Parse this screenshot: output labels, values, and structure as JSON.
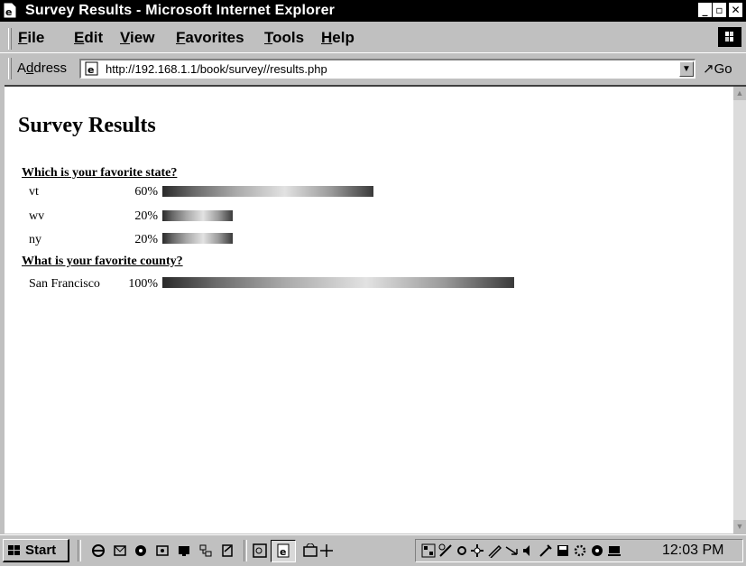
{
  "window": {
    "title": "Survey Results - Microsoft Internet Explorer",
    "controls": {
      "minimize": "_",
      "maximize": "▫",
      "close": "✕"
    }
  },
  "menu": [
    "File",
    "Edit",
    "View",
    "Favorites",
    "Tools",
    "Help"
  ],
  "address_bar": {
    "label_prefix": "A",
    "label_underlined": "d",
    "label_rest": "dress",
    "url": "http://192.168.1.1/book/survey//results.php",
    "go": "Go"
  },
  "page": {
    "heading": "Survey Results",
    "questions": [
      {
        "question": "Which is your favorite state?",
        "answers": [
          {
            "label": "vt",
            "percent_text": "60%",
            "percent": 60
          },
          {
            "label": "wv",
            "percent_text": "20%",
            "percent": 20
          },
          {
            "label": "ny",
            "percent_text": "20%",
            "percent": 20
          }
        ]
      },
      {
        "question": "What is your favorite county?",
        "answers": [
          {
            "label": "San Francisco",
            "percent_text": "100%",
            "percent": 100
          }
        ]
      }
    ]
  },
  "taskbar": {
    "start": "Start",
    "clock": "12:03 PM"
  },
  "icons": {
    "title": "ie-page-icon",
    "throbber": "windows-logo-throbber",
    "start": "windows-flag-icon"
  }
}
